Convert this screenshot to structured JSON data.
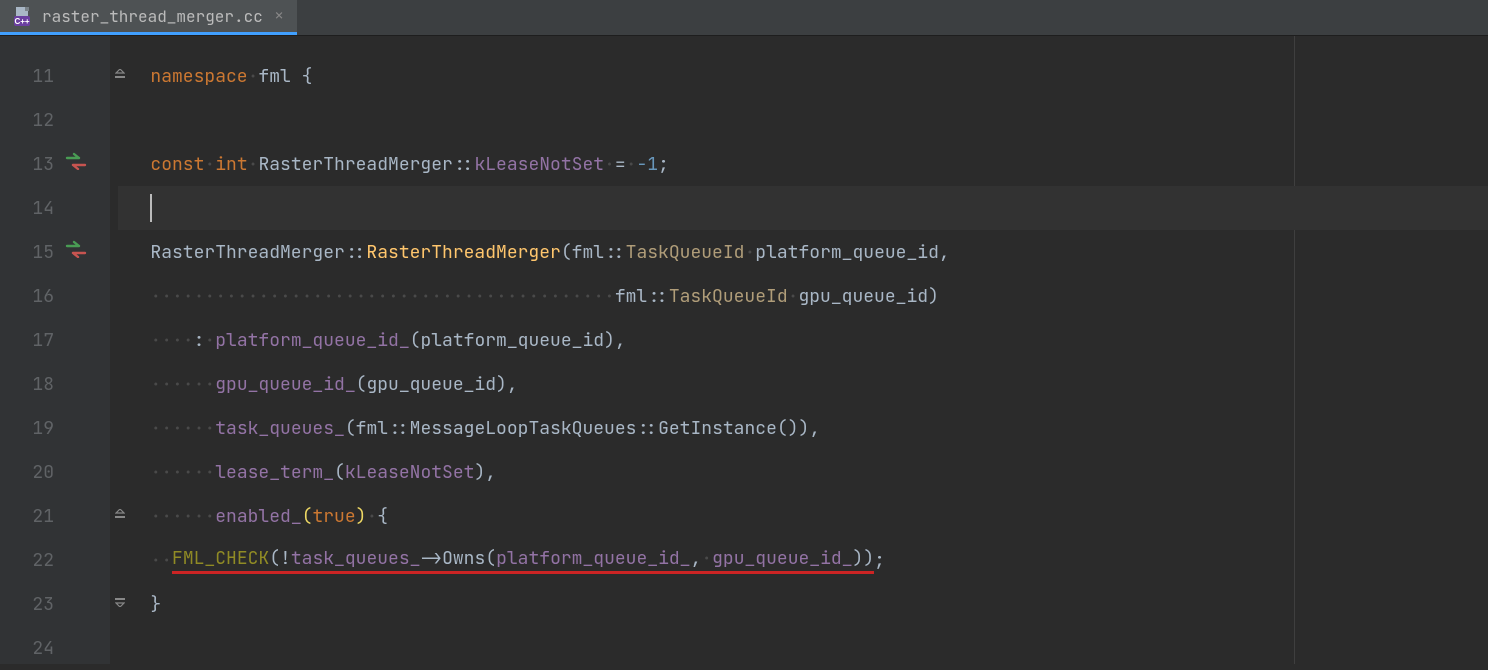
{
  "tab": {
    "filename": "raster_thread_merger.cc",
    "icon": "cpp-file-icon"
  },
  "lines": [
    {
      "num": 11,
      "fold": "open",
      "tokens": [
        {
          "cls": "tok-keyword",
          "text": "namespace"
        },
        {
          "cls": "ws-dot",
          "text": "·"
        },
        {
          "cls": "tok-identifier",
          "text": "fml"
        },
        {
          "cls": "",
          "text": " "
        },
        {
          "cls": "tok-identifier",
          "text": "{"
        }
      ]
    },
    {
      "num": 12,
      "tokens": []
    },
    {
      "num": 13,
      "vcs": "changed",
      "tokens": [
        {
          "cls": "tok-keyword",
          "text": "const"
        },
        {
          "cls": "ws-dot",
          "text": "·"
        },
        {
          "cls": "tok-keyword",
          "text": "int"
        },
        {
          "cls": "ws-dot",
          "text": "·"
        },
        {
          "cls": "tok-identifier",
          "text": "RasterThreadMerger"
        },
        {
          "cls": "tok-identifier",
          "text": "::"
        },
        {
          "cls": "tok-member",
          "text": "kLeaseNotSet"
        },
        {
          "cls": "ws-dot",
          "text": "·"
        },
        {
          "cls": "tok-identifier",
          "text": "="
        },
        {
          "cls": "ws-dot",
          "text": "·"
        },
        {
          "cls": "tok-number",
          "text": "-1"
        },
        {
          "cls": "tok-identifier",
          "text": ";"
        }
      ]
    },
    {
      "num": 14,
      "highlight": true,
      "caret": true,
      "tokens": []
    },
    {
      "num": 15,
      "vcs": "changed",
      "tokens": [
        {
          "cls": "tok-identifier",
          "text": "RasterThreadMerger"
        },
        {
          "cls": "tok-identifier",
          "text": "::"
        },
        {
          "cls": "tok-func",
          "text": "RasterThreadMerger"
        },
        {
          "cls": "tok-identifier",
          "text": "("
        },
        {
          "cls": "tok-identifier",
          "text": "fml"
        },
        {
          "cls": "tok-identifier",
          "text": "::"
        },
        {
          "cls": "tok-type",
          "text": "TaskQueueId"
        },
        {
          "cls": "ws-dot",
          "text": "·"
        },
        {
          "cls": "tok-identifier",
          "text": "platform_queue_id"
        },
        {
          "cls": "tok-identifier",
          "text": ","
        }
      ]
    },
    {
      "num": 16,
      "tokens": [
        {
          "cls": "ws-dot",
          "text": "···········································"
        },
        {
          "cls": "tok-identifier",
          "text": "fml"
        },
        {
          "cls": "tok-identifier",
          "text": "::"
        },
        {
          "cls": "tok-type",
          "text": "TaskQueueId"
        },
        {
          "cls": "ws-dot",
          "text": "·"
        },
        {
          "cls": "tok-identifier",
          "text": "gpu_queue_id"
        },
        {
          "cls": "tok-identifier",
          "text": ")"
        }
      ]
    },
    {
      "num": 17,
      "tokens": [
        {
          "cls": "ws-dot",
          "text": "····"
        },
        {
          "cls": "tok-identifier",
          "text": ":"
        },
        {
          "cls": "ws-dot",
          "text": "·"
        },
        {
          "cls": "tok-member",
          "text": "platform_queue_id_"
        },
        {
          "cls": "tok-identifier",
          "text": "("
        },
        {
          "cls": "tok-identifier",
          "text": "platform_queue_id"
        },
        {
          "cls": "tok-identifier",
          "text": ")"
        },
        {
          "cls": "tok-identifier",
          "text": ","
        }
      ]
    },
    {
      "num": 18,
      "tokens": [
        {
          "cls": "ws-dot",
          "text": "······"
        },
        {
          "cls": "tok-member",
          "text": "gpu_queue_id_"
        },
        {
          "cls": "tok-identifier",
          "text": "("
        },
        {
          "cls": "tok-identifier",
          "text": "gpu_queue_id"
        },
        {
          "cls": "tok-identifier",
          "text": ")"
        },
        {
          "cls": "tok-identifier",
          "text": ","
        }
      ]
    },
    {
      "num": 19,
      "tokens": [
        {
          "cls": "ws-dot",
          "text": "······"
        },
        {
          "cls": "tok-member",
          "text": "task_queues_"
        },
        {
          "cls": "tok-identifier",
          "text": "("
        },
        {
          "cls": "tok-identifier",
          "text": "fml"
        },
        {
          "cls": "tok-identifier",
          "text": "::"
        },
        {
          "cls": "tok-identifier",
          "text": "MessageLoopTaskQueues"
        },
        {
          "cls": "tok-identifier",
          "text": "::"
        },
        {
          "cls": "tok-identifier",
          "text": "GetInstance"
        },
        {
          "cls": "tok-identifier",
          "text": "("
        },
        {
          "cls": "tok-identifier",
          "text": ")"
        },
        {
          "cls": "tok-identifier",
          "text": ")"
        },
        {
          "cls": "tok-identifier",
          "text": ","
        }
      ]
    },
    {
      "num": 20,
      "tokens": [
        {
          "cls": "ws-dot",
          "text": "······"
        },
        {
          "cls": "tok-member",
          "text": "lease_term_"
        },
        {
          "cls": "tok-identifier",
          "text": "("
        },
        {
          "cls": "tok-member",
          "text": "kLeaseNotSet"
        },
        {
          "cls": "tok-identifier",
          "text": ")"
        },
        {
          "cls": "tok-identifier",
          "text": ","
        }
      ]
    },
    {
      "num": 21,
      "fold": "open",
      "tokens": [
        {
          "cls": "ws-dot",
          "text": "······"
        },
        {
          "cls": "tok-member",
          "text": "enabled_"
        },
        {
          "cls": "tok-paren-pair",
          "text": "("
        },
        {
          "cls": "tok-literal",
          "text": "true"
        },
        {
          "cls": "tok-paren-pair",
          "text": ")"
        },
        {
          "cls": "ws-dot",
          "text": "·"
        },
        {
          "cls": "tok-identifier",
          "text": "{"
        }
      ]
    },
    {
      "num": 22,
      "tokens": [
        {
          "cls": "ws-dot",
          "text": "··"
        },
        {
          "cls": "tok-macro red-underline",
          "text": "FML_CHECK"
        },
        {
          "cls": "tok-identifier red-underline",
          "text": "("
        },
        {
          "cls": "tok-identifier red-underline",
          "text": "!"
        },
        {
          "cls": "tok-member red-underline",
          "text": "task_queues_"
        },
        {
          "cls": "tok-identifier red-underline",
          "text": "->"
        },
        {
          "cls": "tok-identifier red-underline",
          "text": "Owns"
        },
        {
          "cls": "tok-identifier red-underline",
          "text": "("
        },
        {
          "cls": "tok-param-hl red-underline",
          "text": "platform_queue_id_"
        },
        {
          "cls": "tok-identifier red-underline",
          "text": ","
        },
        {
          "cls": "ws-dot red-underline",
          "text": "·"
        },
        {
          "cls": "tok-param-hl red-underline",
          "text": "gpu_queue_id_"
        },
        {
          "cls": "tok-identifier red-underline",
          "text": "))"
        },
        {
          "cls": "tok-identifier",
          "text": ";"
        }
      ]
    },
    {
      "num": 23,
      "fold": "close",
      "tokens": [
        {
          "cls": "tok-identifier",
          "text": "}"
        }
      ]
    },
    {
      "num": 24,
      "tokens": []
    }
  ]
}
